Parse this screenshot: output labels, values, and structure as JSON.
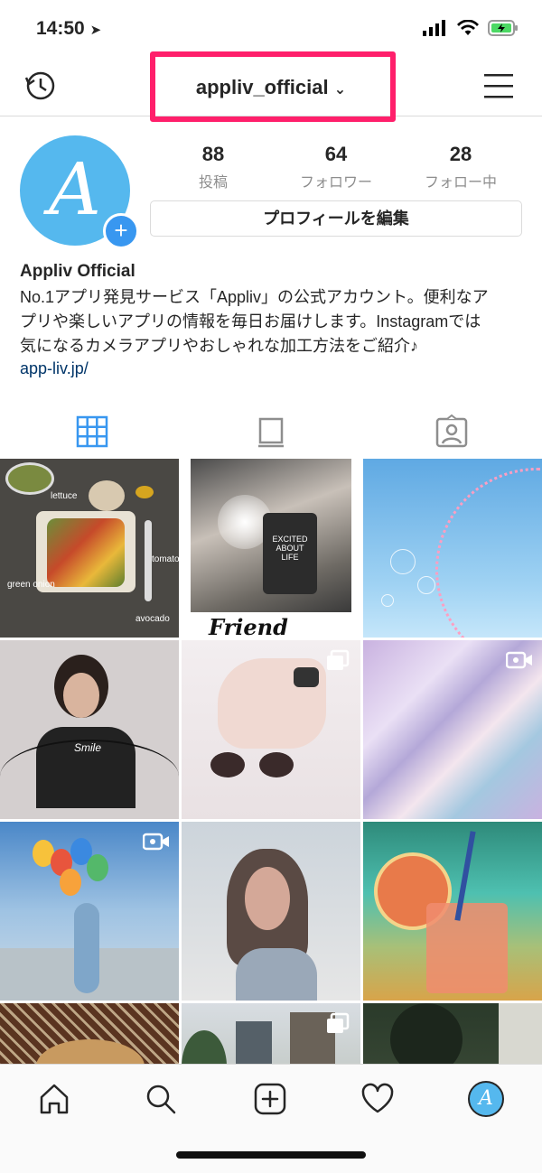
{
  "status": {
    "time": "14:50"
  },
  "header": {
    "username": "appliv_official",
    "dropdown_icon": "chevron-down-icon"
  },
  "profile": {
    "avatar_letter": "A",
    "stats": [
      {
        "value": "88",
        "label": "投稿"
      },
      {
        "value": "64",
        "label": "フォロワー"
      },
      {
        "value": "28",
        "label": "フォロー中"
      }
    ],
    "edit_button": "プロフィールを編集",
    "name": "Appliv Official",
    "bio_lines": [
      "No.1アプリ発見サービス「Appliv」の公式アカウント。便利なア",
      "プリや楽しいアプリの情報を毎日お届けします。Instagramでは",
      "気になるカメラアプリやおしゃれな加工方法をご紹介♪"
    ],
    "link": "app-liv.jp/"
  },
  "tabs": [
    "grid-icon",
    "feed-icon",
    "tagged-icon"
  ],
  "posts": [
    {
      "kind": "photo",
      "caption_labels": [
        "lettuce",
        "tomato",
        "green onion",
        "avocado"
      ]
    },
    {
      "kind": "photo",
      "caption_labels": [
        "EXCITED ABOUT LIFE",
        "Friend"
      ]
    },
    {
      "kind": "photo"
    },
    {
      "kind": "photo",
      "caption_labels": [
        "Smile"
      ]
    },
    {
      "kind": "carousel"
    },
    {
      "kind": "video"
    },
    {
      "kind": "video"
    },
    {
      "kind": "photo"
    },
    {
      "kind": "photo"
    },
    {
      "kind": "photo"
    },
    {
      "kind": "carousel"
    },
    {
      "kind": "photo"
    }
  ],
  "bottom_nav": [
    "home-icon",
    "search-icon",
    "add-post-icon",
    "activity-heart-icon",
    "profile-avatar"
  ],
  "colors": {
    "accent": "#3897f0",
    "highlight": "#ff1f6b",
    "link": "#003569",
    "avatar": "#55b8ee"
  }
}
